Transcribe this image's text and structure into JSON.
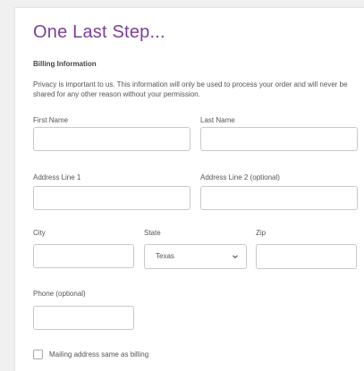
{
  "page": {
    "title": "One Last Step...",
    "section_title": "Billing Information",
    "privacy_note": "Privacy is important to us. This information will only be used to process your order and will never be shared for any other reason without your permission."
  },
  "form": {
    "first_name": {
      "label": "First Name",
      "value": ""
    },
    "last_name": {
      "label": "Last Name",
      "value": ""
    },
    "address1": {
      "label": "Address Line 1",
      "value": ""
    },
    "address2": {
      "label": "Address Line 2 (optional)",
      "value": ""
    },
    "city": {
      "label": "City",
      "value": ""
    },
    "state": {
      "label": "State",
      "selected": "Texas",
      "icon": "chevron-down-icon"
    },
    "zip": {
      "label": "Zip",
      "value": ""
    },
    "phone": {
      "label": "Phone (optional)",
      "value": ""
    },
    "mailing_same": {
      "label": "Mailing address same as billing",
      "checked": false
    }
  },
  "colors": {
    "accent": "#7b3f98",
    "border": "#c8c8c8",
    "text": "#555555",
    "page_bg": "#f0f0f0"
  }
}
